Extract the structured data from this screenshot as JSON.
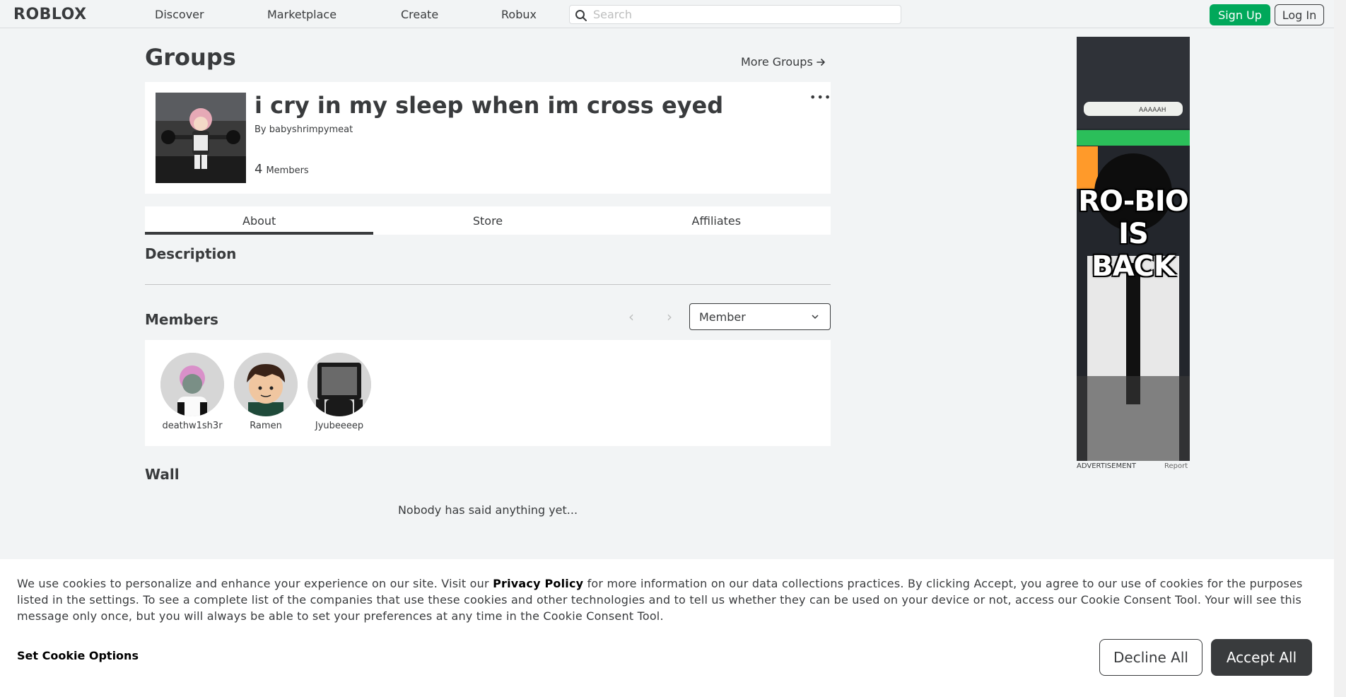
{
  "header": {
    "logo": "ROBLOX",
    "nav": [
      "Discover",
      "Marketplace",
      "Create",
      "Robux"
    ],
    "search_placeholder": "Search",
    "signup_label": "Sign Up",
    "login_label": "Log In"
  },
  "page": {
    "title": "Groups",
    "more_groups": "More Groups"
  },
  "group": {
    "name": "i cry in my sleep when im cross eyed",
    "owner_prefix": "By",
    "owner": "babyshrimpymeat",
    "member_count": "4",
    "member_label": "Members",
    "menu": "•••"
  },
  "tabs": [
    "About",
    "Store",
    "Affiliates"
  ],
  "about": {
    "description_title": "Description",
    "members_title": "Members",
    "role_selected": "Member",
    "members": [
      {
        "name": "deathw1sh3r"
      },
      {
        "name": "Ramen"
      },
      {
        "name": "Jyubeeeep"
      }
    ],
    "wall_title": "Wall",
    "wall_empty": "Nobody has said anything yet..."
  },
  "ad": {
    "text": "RO-BIO IS BACK",
    "label": "ADVERTISEMENT",
    "report": "Report",
    "caption": "AAAAAH"
  },
  "cookie": {
    "text_before": "We use cookies to personalize and enhance your experience on our site. Visit our ",
    "privacy_link": "Privacy Policy",
    "text_after": " for more information on our data collections practices. By clicking Accept, you agree to our use of cookies for the purposes listed in the settings. To see a complete list of the companies that use these cookies and other technologies and to tell us whether they can be used on your device or not, access our Cookie Consent Tool. Your will see this message only once, but you will always be able to set your preferences at any time in the Cookie Consent Tool.",
    "options_label": "Set Cookie Options",
    "decline_label": "Decline All",
    "accept_label": "Accept All"
  }
}
